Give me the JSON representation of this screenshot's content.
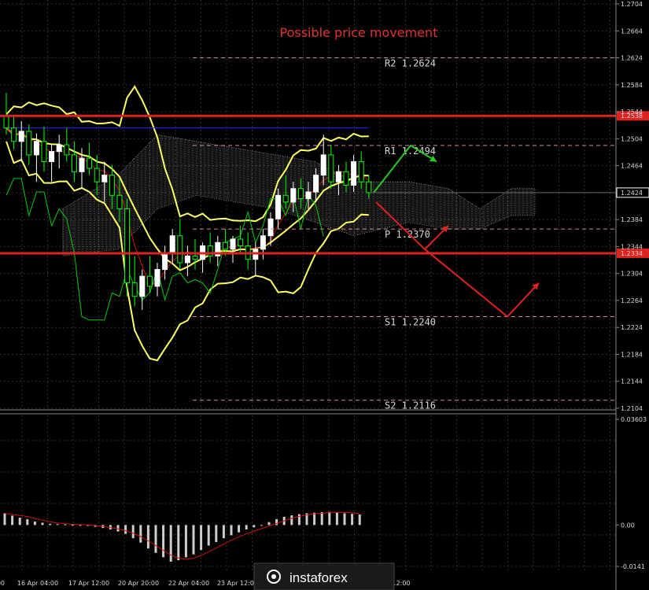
{
  "chart_data": {
    "type": "candlestick",
    "instrument_panel_title": "Possible price movement",
    "price_axis": {
      "ticks": [
        "1.2704",
        "1.2664",
        "1.2624",
        "1.2584",
        "1.2544",
        "1.2504",
        "1.2464",
        "1.2424",
        "1.2384",
        "1.2344",
        "1.2304",
        "1.2264",
        "1.2224",
        "1.2184",
        "1.2144",
        "1.2104"
      ],
      "range": [
        1.2104,
        1.2704
      ],
      "current_price": "1.2424",
      "red_level_labels": [
        "1.2538",
        "1.2334"
      ]
    },
    "red_levels": [
      {
        "value": 1.2538
      },
      {
        "value": 1.2334
      }
    ],
    "pivot_levels": [
      {
        "label": "R2 1.2624",
        "value": 1.2624
      },
      {
        "label": "R1 1.2494",
        "value": 1.2494
      },
      {
        "label": "P 1.2370",
        "value": 1.237
      },
      {
        "label": "S1 1.2240",
        "value": 1.224
      },
      {
        "label": "S2 1.2116",
        "value": 1.2116
      }
    ],
    "time_labels": [
      "00",
      "16 Apr 04:00",
      "17 Apr 12:00",
      "20 Apr 20:00",
      "22 Apr 04:00",
      "23 Apr 12:00",
      "12:00"
    ],
    "candles": [
      {
        "o": 1.2538,
        "h": 1.2572,
        "l": 1.251,
        "c": 1.252
      },
      {
        "o": 1.252,
        "h": 1.254,
        "l": 1.2488,
        "c": 1.25
      },
      {
        "o": 1.25,
        "h": 1.253,
        "l": 1.247,
        "c": 1.2515
      },
      {
        "o": 1.2515,
        "h": 1.2525,
        "l": 1.2465,
        "c": 1.248
      },
      {
        "o": 1.248,
        "h": 1.2512,
        "l": 1.244,
        "c": 1.25
      },
      {
        "o": 1.25,
        "h": 1.2522,
        "l": 1.2455,
        "c": 1.247
      },
      {
        "o": 1.247,
        "h": 1.2495,
        "l": 1.244,
        "c": 1.2485
      },
      {
        "o": 1.2485,
        "h": 1.251,
        "l": 1.246,
        "c": 1.2495
      },
      {
        "o": 1.2495,
        "h": 1.252,
        "l": 1.247,
        "c": 1.248
      },
      {
        "o": 1.248,
        "h": 1.25,
        "l": 1.244,
        "c": 1.2455
      },
      {
        "o": 1.2455,
        "h": 1.249,
        "l": 1.243,
        "c": 1.2475
      },
      {
        "o": 1.2475,
        "h": 1.2498,
        "l": 1.245,
        "c": 1.246
      },
      {
        "o": 1.246,
        "h": 1.248,
        "l": 1.242,
        "c": 1.244
      },
      {
        "o": 1.244,
        "h": 1.247,
        "l": 1.241,
        "c": 1.245
      },
      {
        "o": 1.245,
        "h": 1.2465,
        "l": 1.24,
        "c": 1.242
      },
      {
        "o": 1.242,
        "h": 1.2445,
        "l": 1.238,
        "c": 1.24
      },
      {
        "o": 1.24,
        "h": 1.2415,
        "l": 1.227,
        "c": 1.229
      },
      {
        "o": 1.229,
        "h": 1.233,
        "l": 1.2255,
        "c": 1.227
      },
      {
        "o": 1.227,
        "h": 1.231,
        "l": 1.225,
        "c": 1.23
      },
      {
        "o": 1.23,
        "h": 1.233,
        "l": 1.2275,
        "c": 1.2285
      },
      {
        "o": 1.2285,
        "h": 1.232,
        "l": 1.227,
        "c": 1.231
      },
      {
        "o": 1.231,
        "h": 1.2345,
        "l": 1.2295,
        "c": 1.2335
      },
      {
        "o": 1.2335,
        "h": 1.237,
        "l": 1.232,
        "c": 1.236
      },
      {
        "o": 1.236,
        "h": 1.2385,
        "l": 1.231,
        "c": 1.232
      },
      {
        "o": 1.232,
        "h": 1.2345,
        "l": 1.23,
        "c": 1.233
      },
      {
        "o": 1.233,
        "h": 1.2355,
        "l": 1.231,
        "c": 1.2325
      },
      {
        "o": 1.2325,
        "h": 1.235,
        "l": 1.2305,
        "c": 1.2345
      },
      {
        "o": 1.2345,
        "h": 1.2365,
        "l": 1.232,
        "c": 1.233
      },
      {
        "o": 1.233,
        "h": 1.236,
        "l": 1.2315,
        "c": 1.235
      },
      {
        "o": 1.235,
        "h": 1.237,
        "l": 1.233,
        "c": 1.234
      },
      {
        "o": 1.234,
        "h": 1.236,
        "l": 1.232,
        "c": 1.2355
      },
      {
        "o": 1.2355,
        "h": 1.2375,
        "l": 1.2335,
        "c": 1.2345
      },
      {
        "o": 1.2345,
        "h": 1.2365,
        "l": 1.231,
        "c": 1.2325
      },
      {
        "o": 1.2325,
        "h": 1.235,
        "l": 1.23,
        "c": 1.234
      },
      {
        "o": 1.234,
        "h": 1.237,
        "l": 1.2325,
        "c": 1.236
      },
      {
        "o": 1.236,
        "h": 1.2395,
        "l": 1.2345,
        "c": 1.2385
      },
      {
        "o": 1.2385,
        "h": 1.243,
        "l": 1.237,
        "c": 1.242
      },
      {
        "o": 1.242,
        "h": 1.245,
        "l": 1.24,
        "c": 1.241
      },
      {
        "o": 1.241,
        "h": 1.244,
        "l": 1.2395,
        "c": 1.243
      },
      {
        "o": 1.243,
        "h": 1.2445,
        "l": 1.24,
        "c": 1.2415
      },
      {
        "o": 1.2415,
        "h": 1.244,
        "l": 1.24,
        "c": 1.2425
      },
      {
        "o": 1.2425,
        "h": 1.246,
        "l": 1.241,
        "c": 1.245
      },
      {
        "o": 1.245,
        "h": 1.251,
        "l": 1.2435,
        "c": 1.248
      },
      {
        "o": 1.248,
        "h": 1.2495,
        "l": 1.243,
        "c": 1.244
      },
      {
        "o": 1.244,
        "h": 1.2465,
        "l": 1.242,
        "c": 1.2455
      },
      {
        "o": 1.2455,
        "h": 1.247,
        "l": 1.2425,
        "c": 1.2435
      },
      {
        "o": 1.2435,
        "h": 1.248,
        "l": 1.2425,
        "c": 1.247
      },
      {
        "o": 1.247,
        "h": 1.2485,
        "l": 1.243,
        "c": 1.244
      },
      {
        "o": 1.244,
        "h": 1.245,
        "l": 1.2415,
        "c": 1.2424
      }
    ],
    "scenario_arrows": [
      {
        "color": "#22cc22",
        "points": [
          [
            1.2424
          ],
          [
            1.2494
          ],
          [
            1.247
          ]
        ]
      },
      {
        "color": "#dd2222",
        "points": [
          [
            1.241
          ],
          [
            1.234
          ],
          [
            1.2375
          ]
        ]
      },
      {
        "color": "#dd2222",
        "points": [
          [
            1.234
          ],
          [
            1.224
          ],
          [
            1.229
          ]
        ]
      }
    ],
    "macd_axis": {
      "ticks": [
        "0.03603",
        "0.00",
        "-0.0141"
      ]
    },
    "macd_histogram": [
      0.004,
      0.0032,
      0.0025,
      0.002,
      0.0012,
      0.0008,
      0.0004,
      0.0003,
      0.0002,
      0.0001,
      0.0,
      -0.0003,
      -0.0006,
      -0.001,
      -0.0015,
      -0.0022,
      -0.003,
      -0.0045,
      -0.006,
      -0.008,
      -0.0095,
      -0.011,
      -0.0125,
      -0.012,
      -0.011,
      -0.01,
      -0.0085,
      -0.007,
      -0.0058,
      -0.0045,
      -0.0035,
      -0.0025,
      -0.0015,
      -0.0008,
      0.0,
      0.001,
      0.002,
      0.0028,
      0.0033,
      0.0037,
      0.004,
      0.0042,
      0.0044,
      0.0045,
      0.0043,
      0.004,
      0.0038,
      0.0036
    ],
    "colors": {
      "candle_bull": "#ffffff",
      "candle_bear": "#00ff00",
      "bollinger": "#ffff66",
      "ema_red": "#cc1111",
      "kijun_blue": "#2222ff",
      "chikou_green": "#00cc00",
      "red_level": "#dd2222",
      "macd_hist": "#cccccc",
      "macd_signal": "#cc1111"
    }
  },
  "watermark": {
    "text": "instaforex"
  }
}
